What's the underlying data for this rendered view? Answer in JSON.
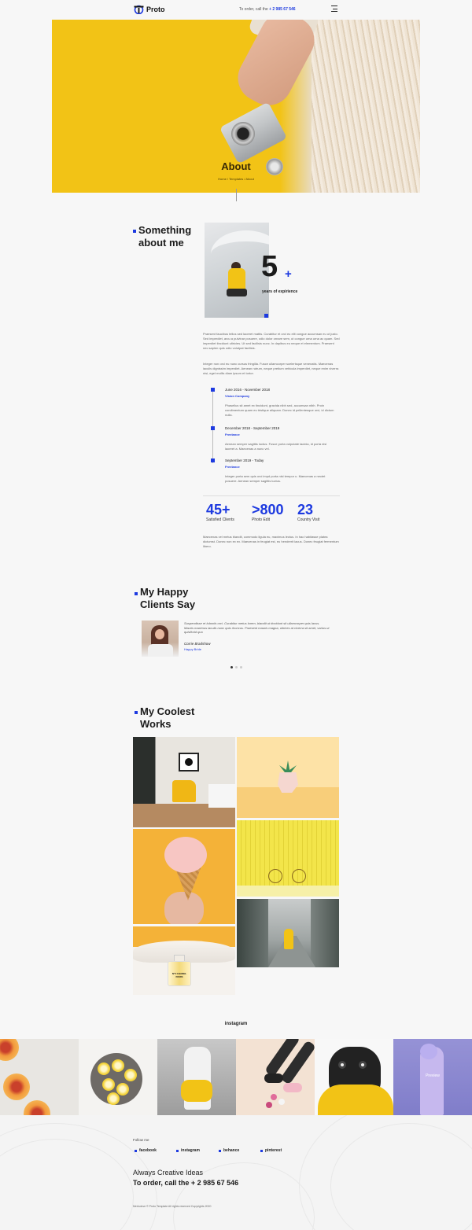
{
  "header": {
    "logo_text": "Proto",
    "order_prefix": "To order, call the",
    "phone": "+ 2 985 67 546"
  },
  "hero": {
    "title": "About",
    "breadcrumb": "Home / Templates / About"
  },
  "about": {
    "title_line1": "Something",
    "title_line2": "about me",
    "years_value": "5",
    "years_plus": "+",
    "years_label": "years of expirience",
    "para1": "Praesent faucibus tellus sed laoreet mattis. Curabitur et orci eu elit congue accumsan eu ut justo. Sed imperdiet, arcu a pulvinar posuere, odio dolor ornare sem, ut congue urna urna ac quam. Sed imperdiet tincidunt ultricies. Ut sed facilisis nunc. In dapibus eu neque et elementum. Praesent nec sapien quis odio volutpat facilisis.",
    "para2": "Integer non orci eu nunc cursus fringilla. Fusce ullamcorper scelerisque venenatis. Maecenas iaculis dignissim imperdiet. Aenean rutrum, neque pretium vehicula imperdiet, neque enim viverra nisi, eget mollis diam ipsum et tortor.",
    "timeline": [
      {
        "date": "June 2016 - November 2018",
        "company": "Vision Company",
        "text": "Phasellus sit amet ex tincidunt, gravida nibh sed, accumsan nibh. Proin condimentum quam eu tristique aliquam. Donec id pellentesque orci, id dictum nulla."
      },
      {
        "date": "December 2018 - September 2019",
        "company": "Freelance",
        "text": "Aenean semper sagittis luctus. Fusce porta vulputate lacinia, id porta nisl laoreet a. Maecenas a nunc vel."
      },
      {
        "date": "September 2019 - Today",
        "company": "Freelance",
        "text": "Integer porta sem quis orci impd porta nisi tempor u. Maecenas a nectet posuere. Aenean semper sagittis luctus."
      }
    ],
    "stats": [
      {
        "value": "45+",
        "label": "Satisfied Clients"
      },
      {
        "value": ">800",
        "label": "Photo Edit"
      },
      {
        "value": "23",
        "label": "Country Visit"
      }
    ],
    "para3": "Maecenas vel metus blandit, commodo ligula eu, maximus lectus. In hac habitasse platea dictumst. Donec non ex ex. Maecenas in feugiat est, eu hendrerit lacus. Donec feugiat fermentum libero."
  },
  "clients": {
    "title_line1": "My Happy",
    "title_line2": "Clients Say",
    "quote": "Suspendisse et lobortis orci. Curabitur metus lorem, blandit ut tincidunt sit ullamcorper quis lacus. Mauris maximus iaculis nunc quis rhoncus. Praesent mauris magna, ultrices at viverra sit amet, varius ut quisflorid quo",
    "name": "Corrie Bradshow",
    "role": "Happy Bride",
    "dots": 3,
    "active_dot": 0
  },
  "works": {
    "title_line1": "My Coolest",
    "title_line2": "Works",
    "bottle_label": "N°5 CHANEL PARIS"
  },
  "instagram": {
    "title": "instagram",
    "hover_label": "Preview"
  },
  "footer": {
    "follow_label": "Follow me",
    "social": [
      "facebook",
      "instagram",
      "behance",
      "pinterest"
    ],
    "tagline": "Always Creative Ideas",
    "call": "To order, call the + 2 985 67 546",
    "copyright": "Merkulove © Proto Template All rights reserved Copyrights 2020"
  },
  "colors": {
    "accent": "#1d3ae0",
    "hero_yellow": "#f2c316",
    "background": "#f7f7f7"
  }
}
